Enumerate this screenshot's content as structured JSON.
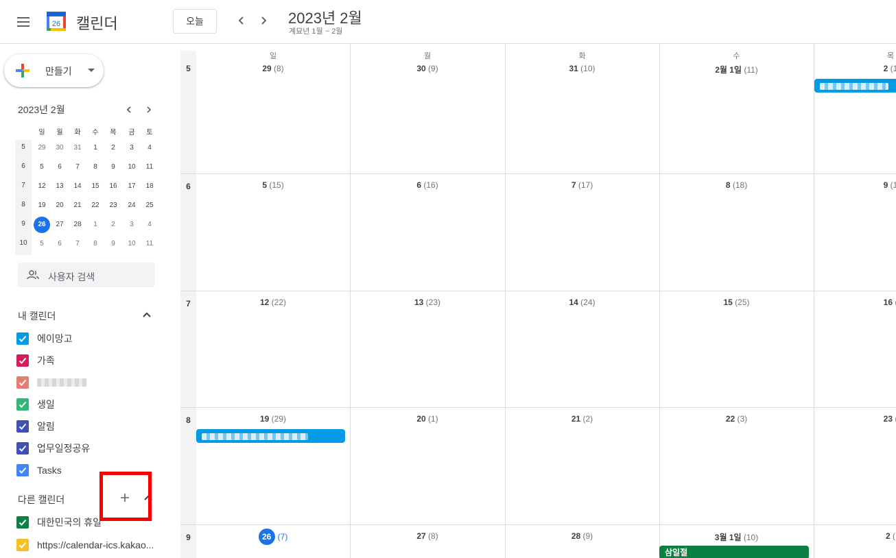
{
  "header": {
    "app_title": "캘린더",
    "logo_day": "26",
    "today_label": "오늘",
    "period_title": "2023년 2월",
    "period_sub": "계묘년 1월 ~ 2월"
  },
  "sidebar": {
    "create_label": "만들기",
    "mini_calendar": {
      "title": "2023년 2월",
      "weekdays": [
        "일",
        "월",
        "화",
        "수",
        "목",
        "금",
        "토"
      ],
      "weeks": [
        {
          "wk": "5",
          "days": [
            "29",
            "30",
            "31",
            "1",
            "2",
            "3",
            "4"
          ]
        },
        {
          "wk": "6",
          "days": [
            "5",
            "6",
            "7",
            "8",
            "9",
            "10",
            "11"
          ]
        },
        {
          "wk": "7",
          "days": [
            "12",
            "13",
            "14",
            "15",
            "16",
            "17",
            "18"
          ]
        },
        {
          "wk": "8",
          "days": [
            "19",
            "20",
            "21",
            "22",
            "23",
            "24",
            "25"
          ]
        },
        {
          "wk": "9",
          "days": [
            "26",
            "27",
            "28",
            "1",
            "2",
            "3",
            "4"
          ]
        },
        {
          "wk": "10",
          "days": [
            "5",
            "6",
            "7",
            "8",
            "9",
            "10",
            "11"
          ]
        }
      ]
    },
    "search_people_label": "사용자 검색",
    "my_calendars_title": "내 캘린더",
    "my_calendars": [
      {
        "name": "에이망고",
        "color": "#039be5"
      },
      {
        "name": "가족",
        "color": "#d81b60"
      },
      {
        "name": "",
        "color": "#e67c73"
      },
      {
        "name": "생일",
        "color": "#33b679"
      },
      {
        "name": "알림",
        "color": "#3f51b5"
      },
      {
        "name": "업무일정공유",
        "color": "#3f51b5"
      },
      {
        "name": "Tasks",
        "color": "#4285f4"
      }
    ],
    "other_calendars_title": "다른 캘린더",
    "other_calendars": [
      {
        "name": "대한민국의 휴일",
        "color": "#0b8043"
      },
      {
        "name": "https://calendar-ics.kakao...",
        "color": "#f6bf26"
      }
    ]
  },
  "grid": {
    "weekdays": [
      "일",
      "월",
      "화",
      "수",
      "목"
    ],
    "weeks": [
      {
        "wk": "5",
        "days": [
          {
            "num": "29",
            "lunar": "(8)"
          },
          {
            "num": "30",
            "lunar": "(9)"
          },
          {
            "num": "31",
            "lunar": "(10)"
          },
          {
            "num": "2월 1일",
            "lunar": "(11)"
          },
          {
            "num": "2",
            "lunar": "(1"
          }
        ]
      },
      {
        "wk": "6",
        "days": [
          {
            "num": "5",
            "lunar": "(15)"
          },
          {
            "num": "6",
            "lunar": "(16)"
          },
          {
            "num": "7",
            "lunar": "(17)"
          },
          {
            "num": "8",
            "lunar": "(18)"
          },
          {
            "num": "9",
            "lunar": "(1"
          }
        ]
      },
      {
        "wk": "7",
        "days": [
          {
            "num": "12",
            "lunar": "(22)"
          },
          {
            "num": "13",
            "lunar": "(23)"
          },
          {
            "num": "14",
            "lunar": "(24)"
          },
          {
            "num": "15",
            "lunar": "(25)"
          },
          {
            "num": "16",
            "lunar": "("
          }
        ]
      },
      {
        "wk": "8",
        "days": [
          {
            "num": "19",
            "lunar": "(29)"
          },
          {
            "num": "20",
            "lunar": "(1)"
          },
          {
            "num": "21",
            "lunar": "(2)"
          },
          {
            "num": "22",
            "lunar": "(3)"
          },
          {
            "num": "23",
            "lunar": "("
          }
        ]
      },
      {
        "wk": "9",
        "days": [
          {
            "num": "26",
            "lunar": "(7)"
          },
          {
            "num": "27",
            "lunar": "(8)"
          },
          {
            "num": "28",
            "lunar": "(9)"
          },
          {
            "num": "3월 1일",
            "lunar": "(10)"
          },
          {
            "num": "2",
            "lunar": "("
          }
        ]
      }
    ],
    "events": {
      "holiday_label": "삼일절",
      "holiday_color": "#0b8043",
      "event_color": "#039be5"
    }
  }
}
